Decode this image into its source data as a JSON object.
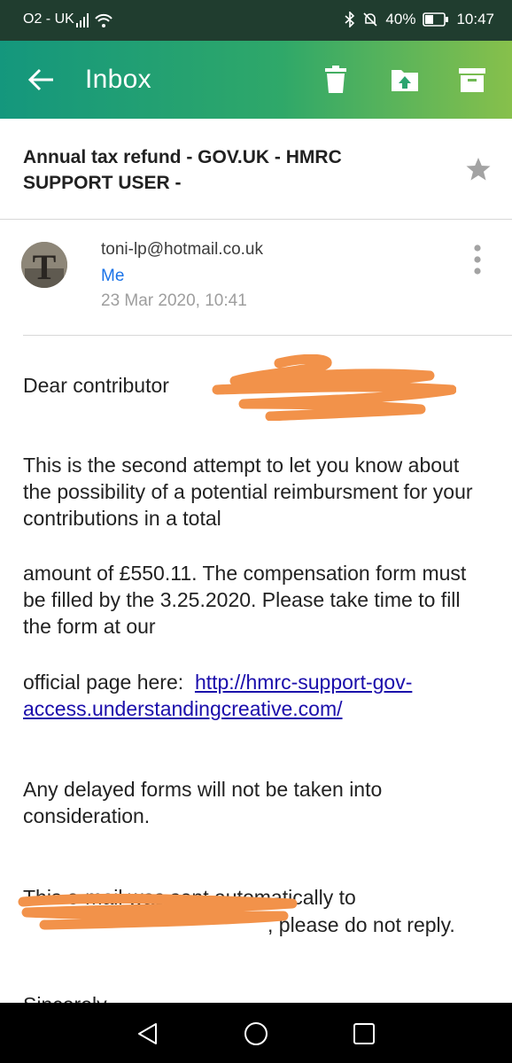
{
  "status_bar": {
    "carrier": "O2 - UK",
    "battery": "40%",
    "time": "10:47"
  },
  "app_bar": {
    "title": "Inbox"
  },
  "email": {
    "subject": "Annual tax refund - GOV.UK - HMRC SUPPORT USER -",
    "avatar_letter": "T",
    "sender": "toni-lp@hotmail.co.uk",
    "recipient": "Me",
    "date": "23 Mar 2020, 10:41",
    "body": {
      "greeting": "Dear contributor",
      "p1": "This is the second attempt to let you know about the possibility of a potential reimbursment for your contributions in a total",
      "p2": "amount of £550.11. The compensation form must be filled by the 3.25.2020. Please take time to fill the form at our",
      "p3_prefix": "official page here:",
      "link": "http://hmrc-support-gov-access.understandingcreative.com/",
      "p4": "Any delayed forms will not be taken into consideration.",
      "p5_line1": "This e-mail was sent automatically to",
      "p5_suffix": ", please do not reply.",
      "signoff": "Sincerely,"
    }
  },
  "colors": {
    "status_bar": "#203d2f",
    "app_bar_start": "#14977d",
    "app_bar_end": "#87c04b",
    "link": "#1a0dab",
    "recipient": "#1a73e8",
    "redaction": "#f2924a"
  },
  "icons": [
    "back-arrow-icon",
    "delete-icon",
    "move-to-folder-icon",
    "archive-icon",
    "star-icon",
    "more-vert-icon",
    "nav-back-icon",
    "nav-home-icon",
    "nav-recents-icon"
  ]
}
